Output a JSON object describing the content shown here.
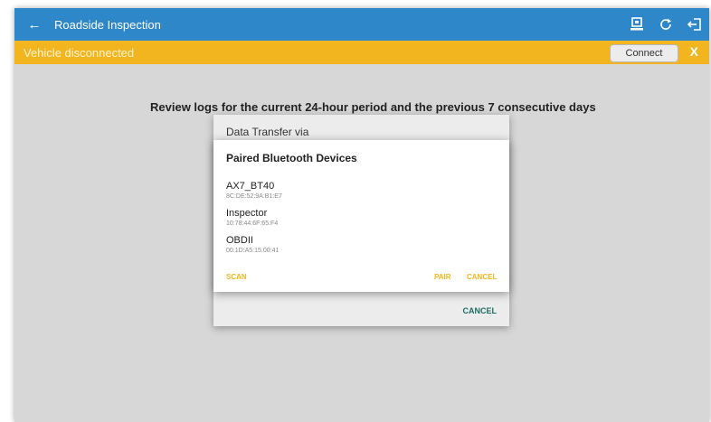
{
  "appbar": {
    "title": "Roadside Inspection",
    "icons": [
      "arrow-back-icon",
      "transfer-icon",
      "refresh-icon",
      "exit-icon"
    ]
  },
  "banner": {
    "status_text": "Vehicle disconnected",
    "connect_label": "Connect",
    "close_label": "X"
  },
  "main": {
    "review_text": "Review logs for the current 24-hour period and the previous 7 consecutive days"
  },
  "transfer_dialog": {
    "title": "Data Transfer via",
    "cancel_label": "CANCEL"
  },
  "bluetooth_dialog": {
    "title": "Paired Bluetooth Devices",
    "devices": [
      {
        "name": "AX7_BT40",
        "mac": "8C:DE:52:9A:B1:E7"
      },
      {
        "name": "Inspector",
        "mac": "10:78:44:6F:65:F4"
      },
      {
        "name": "OBDII",
        "mac": "00:1D:A5:15:00:41"
      }
    ],
    "scan_label": "SCAN",
    "pair_label": "PAIR",
    "cancel_label": "CANCEL"
  },
  "colors": {
    "appbar": "#2e87c9",
    "banner": "#f3b51f",
    "background": "#d7d7d7",
    "dialog_accent": "#f3b51f",
    "cancel_teal": "#1f6b63"
  }
}
